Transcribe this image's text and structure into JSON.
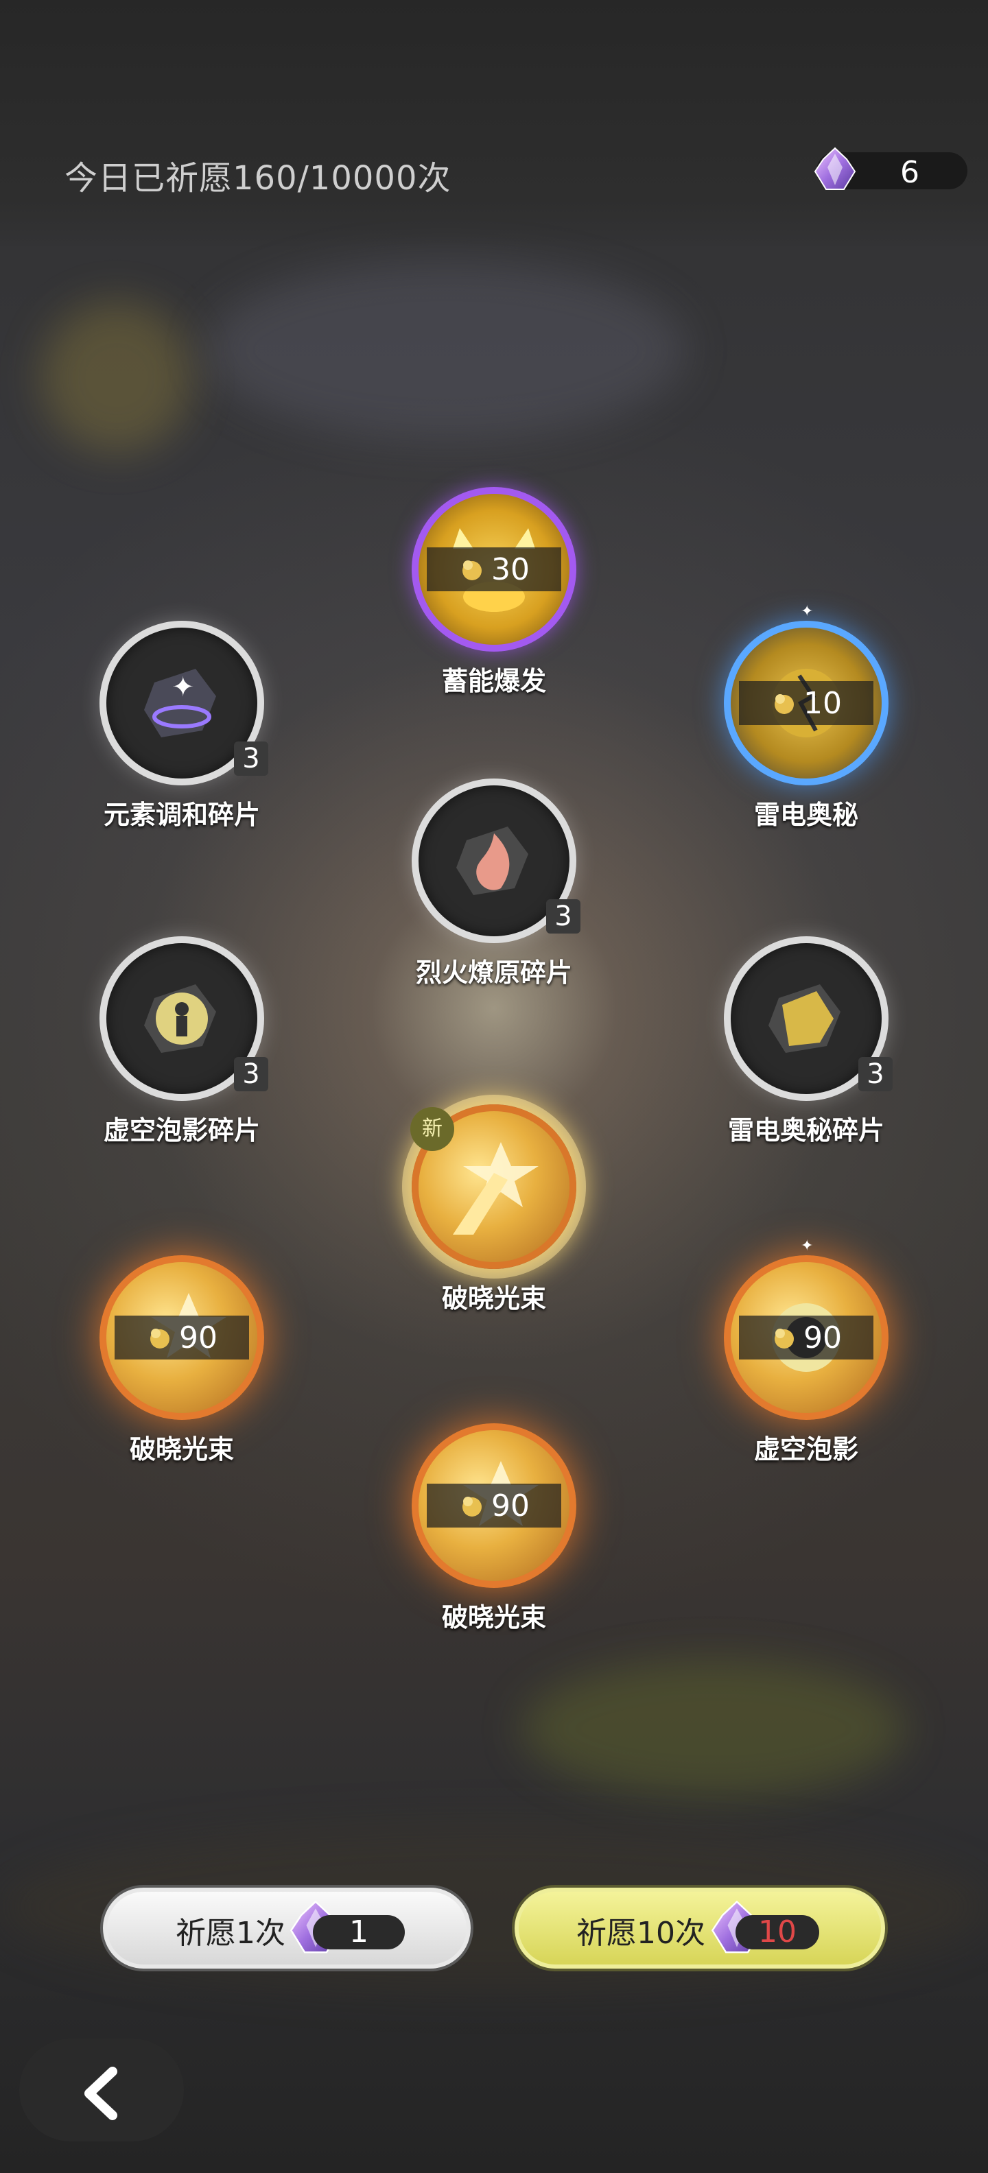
{
  "header": {
    "wish_count_text": "今日已祈愿160/10000次",
    "currency_value": "6"
  },
  "nodes": [
    {
      "id": "energy-burst",
      "label": "蓄能爆发",
      "amount": "30"
    },
    {
      "id": "element-shard",
      "label": "元素调和碎片",
      "count": "3"
    },
    {
      "id": "thunder-secret",
      "label": "雷电奥秘",
      "amount": "10"
    },
    {
      "id": "fire-shard",
      "label": "烈火燎原碎片",
      "count": "3"
    },
    {
      "id": "void-shard",
      "label": "虚空泡影碎片",
      "count": "3"
    },
    {
      "id": "thunder-shard",
      "label": "雷电奥秘碎片",
      "count": "3"
    },
    {
      "id": "dawn-beam-center",
      "label": "破晓光束",
      "badge": "新"
    },
    {
      "id": "dawn-beam-left",
      "label": "破晓光束",
      "amount": "90"
    },
    {
      "id": "void-bubble",
      "label": "虚空泡影",
      "amount": "90"
    },
    {
      "id": "dawn-beam-bottom",
      "label": "破晓光束",
      "amount": "90"
    }
  ],
  "buttons": {
    "wish_once": {
      "label": "祈愿1次",
      "cost": "1"
    },
    "wish_ten": {
      "label": "祈愿10次",
      "cost": "10"
    }
  },
  "colors": {
    "ten_cost": "#e04848",
    "accent_yellow": "#e6e57a",
    "rare_purple": "#a35af0",
    "rare_blue": "#5aa8ff",
    "rare_orange": "#e37a2e"
  }
}
